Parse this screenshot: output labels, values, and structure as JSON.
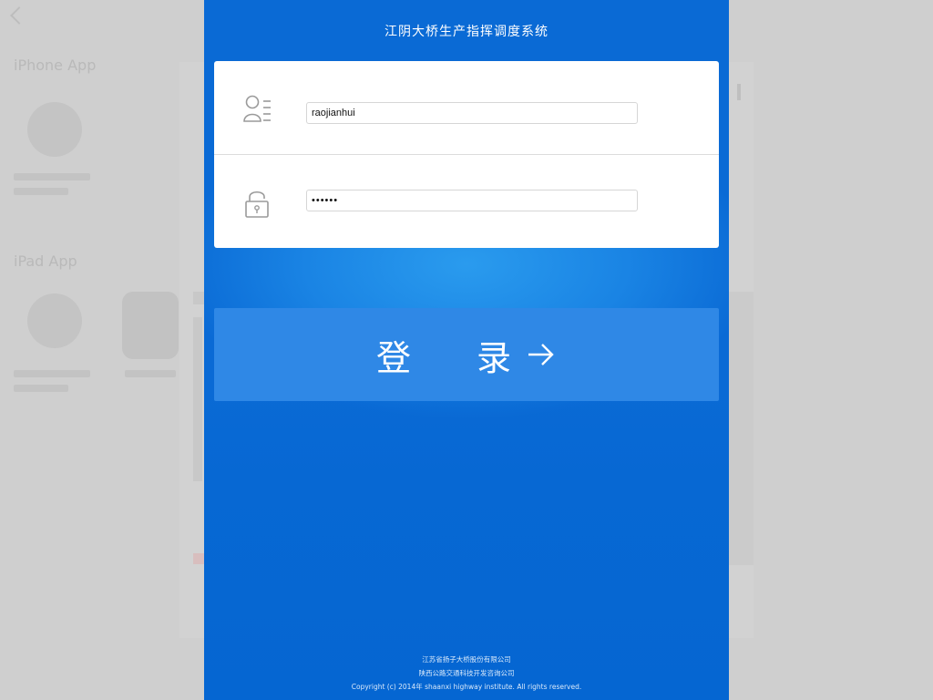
{
  "background": {
    "heading_iphone": "iPhone App",
    "heading_ipad": "iPad App"
  },
  "login": {
    "title": "江阴大桥生产指挥调度系统",
    "username": {
      "value": "raojianhui",
      "icon": "user-list-icon"
    },
    "password": {
      "value": "••••••",
      "icon": "padlock-icon"
    },
    "submit_label": "登 录",
    "submit_icon": "arrow-right-icon",
    "footer": {
      "line1": "江苏省扬子大桥股份有限公司",
      "line2": "陕西公路交通科技开发咨询公司",
      "line3": "Copyright (c) 2014年 shaanxi highway institute. All rights reserved."
    }
  },
  "colors": {
    "panel_blue": "#0a6ad5",
    "button_blue": "#2f88e6",
    "overlay_gray": "#cfcfcf"
  }
}
